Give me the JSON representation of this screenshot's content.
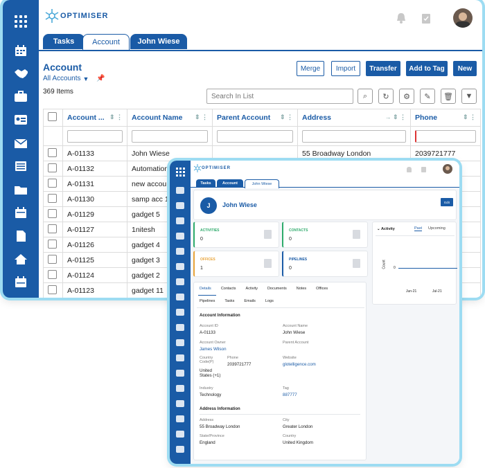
{
  "back": {
    "logo": "OPTIMISER",
    "tabs": [
      "Tasks",
      "Account",
      "John Wiese"
    ],
    "title": "Account",
    "view": "All Accounts",
    "count": "369 Items",
    "buttons": {
      "merge": "Merge",
      "import": "Import",
      "transfer": "Transfer",
      "add_to_tag": "Add to Tag",
      "new": "New"
    },
    "search_placeholder": "Search In List",
    "columns": [
      "Account ...",
      "Account Name",
      "Parent Account",
      "Address",
      "Phone"
    ],
    "rows": [
      {
        "id": "A-01133",
        "name": "John Wiese",
        "parent": "",
        "address": "55 Broadway London",
        "phone": "2039721777"
      },
      {
        "id": "A-01132",
        "name": "Automation",
        "parent": "",
        "address": "",
        "phone": ""
      },
      {
        "id": "A-01131",
        "name": "new accoun",
        "parent": "",
        "address": "",
        "phone": ""
      },
      {
        "id": "A-01130",
        "name": "samp acc 1",
        "parent": "",
        "address": "",
        "phone": ""
      },
      {
        "id": "A-01129",
        "name": "gadget 5",
        "parent": "",
        "address": "",
        "phone": ""
      },
      {
        "id": "A-01127",
        "name": "1nitesh",
        "parent": "",
        "address": "",
        "phone": ""
      },
      {
        "id": "A-01126",
        "name": "gadget 4",
        "parent": "",
        "address": "",
        "phone": ""
      },
      {
        "id": "A-01125",
        "name": "gadget 3",
        "parent": "",
        "address": "",
        "phone": ""
      },
      {
        "id": "A-01124",
        "name": "gadget 2",
        "parent": "",
        "address": "",
        "phone": ""
      },
      {
        "id": "A-01123",
        "name": "gadget 11",
        "parent": "",
        "address": "",
        "phone": ""
      }
    ]
  },
  "front": {
    "logo": "OPTIMISER",
    "tabs": [
      "Tasks",
      "Account",
      "John Wiese"
    ],
    "avatar_letter": "J",
    "name": "John Wiese",
    "edit": "Edit",
    "stats": [
      {
        "label": "ACTIVITIES",
        "value": "0",
        "color": "#2eaa6b"
      },
      {
        "label": "CONTACTS",
        "value": "0",
        "color": "#2eaa6b"
      },
      {
        "label": "OFFICES",
        "value": "1",
        "color": "#e8a338"
      },
      {
        "label": "PIPELINES",
        "value": "0",
        "color": "#1a5ba6"
      }
    ],
    "activity": {
      "title": "Activity",
      "past": "Past",
      "upcoming": "Upcoming",
      "ylabel": "Count",
      "zero": "0",
      "xticks": [
        "Jun-21",
        "Jul-21"
      ]
    },
    "detail_tabs_1": [
      "Details",
      "Contacts",
      "Activity",
      "Documents",
      "Notes",
      "Offices"
    ],
    "detail_tabs_2": [
      "Pipelines",
      "Tasks",
      "Emails",
      "Logs"
    ],
    "account_info_title": "Account Information",
    "fields": {
      "account_id_label": "Account ID",
      "account_id": "A-01133",
      "account_name_label": "Account Name",
      "account_name": "John Wiese",
      "owner_label": "Account Owner",
      "owner": "James Wilson",
      "parent_label": "Parent Account",
      "country_code_label": "Country Code(P)",
      "country_code": "United States (+1)",
      "phone_label": "Phone",
      "phone": "2039721777",
      "website_label": "Website",
      "website": "glotelligence.com",
      "industry_label": "Industry",
      "industry": "Technology",
      "tag_label": "Tag",
      "tag": "887777"
    },
    "address_info_title": "Address Information",
    "address": {
      "address_label": "Address",
      "address": "55 Broadway London",
      "city_label": "City",
      "city": "Greater London",
      "state_label": "State/Province",
      "state": "England",
      "country_label": "Country",
      "country": "United Kingdom"
    }
  }
}
